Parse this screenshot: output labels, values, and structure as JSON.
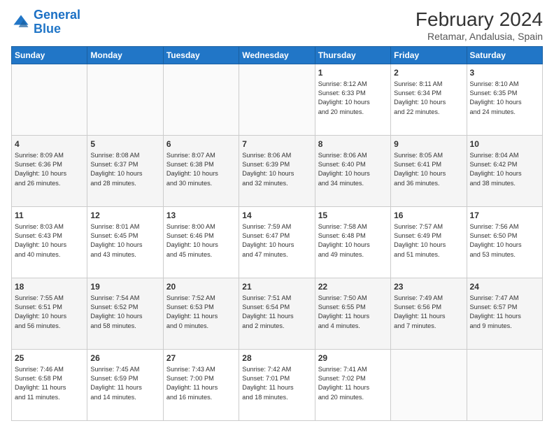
{
  "header": {
    "logo_line1": "General",
    "logo_line2": "Blue",
    "main_title": "February 2024",
    "subtitle": "Retamar, Andalusia, Spain"
  },
  "weekdays": [
    "Sunday",
    "Monday",
    "Tuesday",
    "Wednesday",
    "Thursday",
    "Friday",
    "Saturday"
  ],
  "weeks": [
    [
      {
        "day": "",
        "info": ""
      },
      {
        "day": "",
        "info": ""
      },
      {
        "day": "",
        "info": ""
      },
      {
        "day": "",
        "info": ""
      },
      {
        "day": "1",
        "info": "Sunrise: 8:12 AM\nSunset: 6:33 PM\nDaylight: 10 hours\nand 20 minutes."
      },
      {
        "day": "2",
        "info": "Sunrise: 8:11 AM\nSunset: 6:34 PM\nDaylight: 10 hours\nand 22 minutes."
      },
      {
        "day": "3",
        "info": "Sunrise: 8:10 AM\nSunset: 6:35 PM\nDaylight: 10 hours\nand 24 minutes."
      }
    ],
    [
      {
        "day": "4",
        "info": "Sunrise: 8:09 AM\nSunset: 6:36 PM\nDaylight: 10 hours\nand 26 minutes."
      },
      {
        "day": "5",
        "info": "Sunrise: 8:08 AM\nSunset: 6:37 PM\nDaylight: 10 hours\nand 28 minutes."
      },
      {
        "day": "6",
        "info": "Sunrise: 8:07 AM\nSunset: 6:38 PM\nDaylight: 10 hours\nand 30 minutes."
      },
      {
        "day": "7",
        "info": "Sunrise: 8:06 AM\nSunset: 6:39 PM\nDaylight: 10 hours\nand 32 minutes."
      },
      {
        "day": "8",
        "info": "Sunrise: 8:06 AM\nSunset: 6:40 PM\nDaylight: 10 hours\nand 34 minutes."
      },
      {
        "day": "9",
        "info": "Sunrise: 8:05 AM\nSunset: 6:41 PM\nDaylight: 10 hours\nand 36 minutes."
      },
      {
        "day": "10",
        "info": "Sunrise: 8:04 AM\nSunset: 6:42 PM\nDaylight: 10 hours\nand 38 minutes."
      }
    ],
    [
      {
        "day": "11",
        "info": "Sunrise: 8:03 AM\nSunset: 6:43 PM\nDaylight: 10 hours\nand 40 minutes."
      },
      {
        "day": "12",
        "info": "Sunrise: 8:01 AM\nSunset: 6:45 PM\nDaylight: 10 hours\nand 43 minutes."
      },
      {
        "day": "13",
        "info": "Sunrise: 8:00 AM\nSunset: 6:46 PM\nDaylight: 10 hours\nand 45 minutes."
      },
      {
        "day": "14",
        "info": "Sunrise: 7:59 AM\nSunset: 6:47 PM\nDaylight: 10 hours\nand 47 minutes."
      },
      {
        "day": "15",
        "info": "Sunrise: 7:58 AM\nSunset: 6:48 PM\nDaylight: 10 hours\nand 49 minutes."
      },
      {
        "day": "16",
        "info": "Sunrise: 7:57 AM\nSunset: 6:49 PM\nDaylight: 10 hours\nand 51 minutes."
      },
      {
        "day": "17",
        "info": "Sunrise: 7:56 AM\nSunset: 6:50 PM\nDaylight: 10 hours\nand 53 minutes."
      }
    ],
    [
      {
        "day": "18",
        "info": "Sunrise: 7:55 AM\nSunset: 6:51 PM\nDaylight: 10 hours\nand 56 minutes."
      },
      {
        "day": "19",
        "info": "Sunrise: 7:54 AM\nSunset: 6:52 PM\nDaylight: 10 hours\nand 58 minutes."
      },
      {
        "day": "20",
        "info": "Sunrise: 7:52 AM\nSunset: 6:53 PM\nDaylight: 11 hours\nand 0 minutes."
      },
      {
        "day": "21",
        "info": "Sunrise: 7:51 AM\nSunset: 6:54 PM\nDaylight: 11 hours\nand 2 minutes."
      },
      {
        "day": "22",
        "info": "Sunrise: 7:50 AM\nSunset: 6:55 PM\nDaylight: 11 hours\nand 4 minutes."
      },
      {
        "day": "23",
        "info": "Sunrise: 7:49 AM\nSunset: 6:56 PM\nDaylight: 11 hours\nand 7 minutes."
      },
      {
        "day": "24",
        "info": "Sunrise: 7:47 AM\nSunset: 6:57 PM\nDaylight: 11 hours\nand 9 minutes."
      }
    ],
    [
      {
        "day": "25",
        "info": "Sunrise: 7:46 AM\nSunset: 6:58 PM\nDaylight: 11 hours\nand 11 minutes."
      },
      {
        "day": "26",
        "info": "Sunrise: 7:45 AM\nSunset: 6:59 PM\nDaylight: 11 hours\nand 14 minutes."
      },
      {
        "day": "27",
        "info": "Sunrise: 7:43 AM\nSunset: 7:00 PM\nDaylight: 11 hours\nand 16 minutes."
      },
      {
        "day": "28",
        "info": "Sunrise: 7:42 AM\nSunset: 7:01 PM\nDaylight: 11 hours\nand 18 minutes."
      },
      {
        "day": "29",
        "info": "Sunrise: 7:41 AM\nSunset: 7:02 PM\nDaylight: 11 hours\nand 20 minutes."
      },
      {
        "day": "",
        "info": ""
      },
      {
        "day": "",
        "info": ""
      }
    ]
  ]
}
